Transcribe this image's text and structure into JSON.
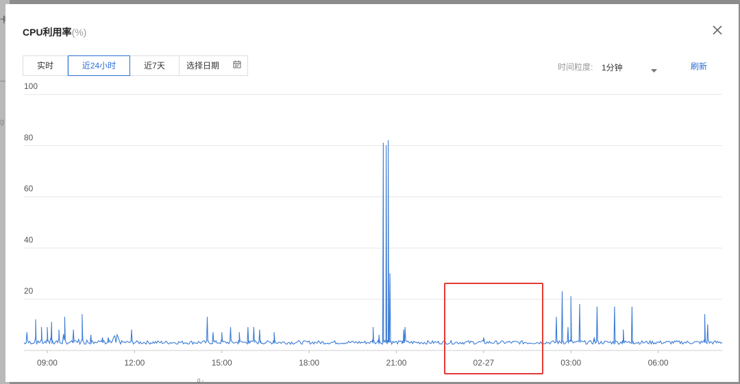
{
  "dialog": {
    "title": "CPU利用率",
    "title_unit": "(%)",
    "close_icon": "close-icon"
  },
  "backdrop": {
    "glyph_top": "卡",
    "glyph_mid": "g"
  },
  "toolbar": {
    "tabs": [
      {
        "label": "实时",
        "active": false
      },
      {
        "label": "近24小时",
        "active": true
      },
      {
        "label": "近7天",
        "active": false
      }
    ],
    "date_picker_label": "选择日期",
    "date_picker_icon": "calendar-icon",
    "granularity_label": "时间粒度:",
    "granularity_value": "1分钟",
    "granularity_caret_icon": "caret-down-icon",
    "refresh_label": "刷新"
  },
  "colors": {
    "accent": "#2a6fd6",
    "line": "#3a7bd5",
    "highlight": "#e53935"
  },
  "chart_data": {
    "type": "line",
    "ylim": [
      0,
      100
    ],
    "y_ticks": [
      "100",
      "80",
      "60",
      "40",
      "20"
    ],
    "x_ticks": [
      "09:00",
      "12:00",
      "15:00",
      "18:00",
      "21:00",
      "02-27",
      "03:00",
      "06:00"
    ],
    "x_tick_hours": [
      9,
      12,
      15,
      18,
      21,
      24,
      27,
      30
    ],
    "x_range_hours": [
      8.2,
      32.2
    ],
    "grid": true,
    "legend": "none",
    "series": [
      {
        "baseline": 3,
        "spikes": [
          [
            8.3,
            7
          ],
          [
            8.6,
            12
          ],
          [
            8.8,
            9
          ],
          [
            9.0,
            9
          ],
          [
            9.15,
            11
          ],
          [
            9.4,
            8
          ],
          [
            9.6,
            13
          ],
          [
            9.9,
            8
          ],
          [
            10.2,
            14
          ],
          [
            10.5,
            6
          ],
          [
            10.9,
            5
          ],
          [
            11.1,
            5
          ],
          [
            11.9,
            8
          ],
          [
            14.5,
            13
          ],
          [
            14.7,
            7
          ],
          [
            15.0,
            7
          ],
          [
            15.3,
            9
          ],
          [
            15.6,
            7
          ],
          [
            15.9,
            9
          ],
          [
            16.1,
            9
          ],
          [
            16.3,
            8
          ],
          [
            16.8,
            7
          ],
          [
            20.2,
            9
          ],
          [
            20.4,
            6
          ],
          [
            20.55,
            81
          ],
          [
            20.65,
            80
          ],
          [
            20.72,
            82
          ],
          [
            20.78,
            30
          ],
          [
            21.25,
            8
          ],
          [
            21.3,
            9
          ],
          [
            24.0,
            5
          ],
          [
            26.5,
            13
          ],
          [
            26.7,
            23
          ],
          [
            26.9,
            9
          ],
          [
            27.0,
            21
          ],
          [
            27.3,
            18
          ],
          [
            27.8,
            5
          ],
          [
            27.9,
            17
          ],
          [
            28.5,
            17
          ],
          [
            28.8,
            8
          ],
          [
            29.1,
            17
          ],
          [
            31.6,
            14
          ],
          [
            31.7,
            10
          ]
        ]
      }
    ]
  },
  "footer": {
    "note": "0 -"
  }
}
